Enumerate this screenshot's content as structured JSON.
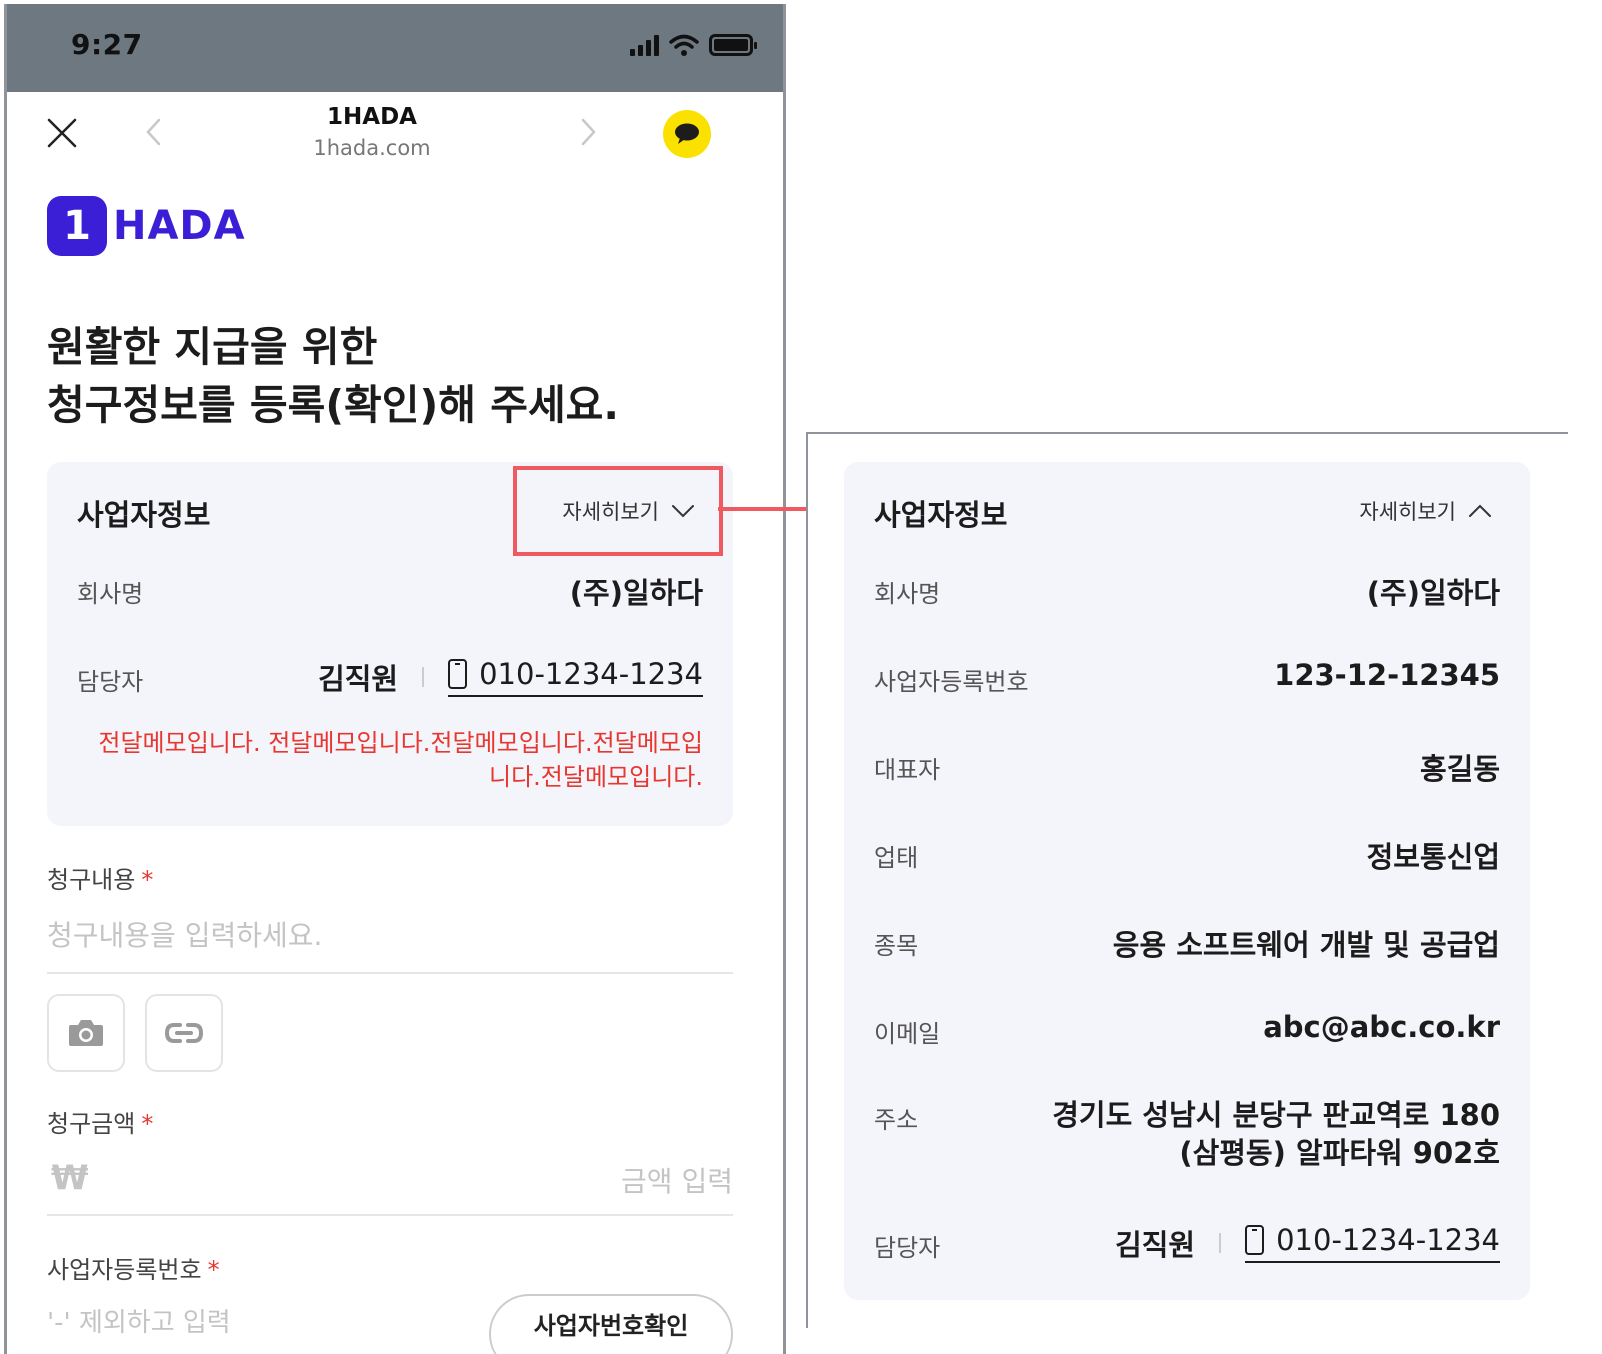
{
  "status_bar": {
    "time": "9:27"
  },
  "browser": {
    "title": "1HADA",
    "url": "1hada.com"
  },
  "logo": {
    "badge": "1",
    "text": "HADA"
  },
  "headline": {
    "line1": "원활한 지급을 위한",
    "line2": "청구정보를 등록(확인)해 주세요."
  },
  "business_card": {
    "title": "사업자정보",
    "toggle_label": "자세히보기",
    "company_label": "회사명",
    "company_value": "(주)일하다",
    "contact_label": "담당자",
    "contact_name": "김직원",
    "contact_phone": "010-1234-1234",
    "memo": "전달메모입니다. 전달메모입니다.전달메모입니다.전달메모입니다.전달메모입니다."
  },
  "form": {
    "content_label": "청구내용",
    "content_placeholder": "청구내용을 입력하세요.",
    "amount_label": "청구금액",
    "currency_symbol": "₩",
    "amount_placeholder": "금액 입력",
    "biz_no_label": "사업자등록번호",
    "biz_no_placeholder": "'-' 제외하고 입력",
    "biz_no_check_button": "사업자번호확인",
    "required_mark": "*"
  },
  "expanded_card": {
    "title": "사업자정보",
    "toggle_label": "자세히보기",
    "rows": [
      {
        "label": "회사명",
        "value": "(주)일하다"
      },
      {
        "label": "사업자등록번호",
        "value": "123-12-12345"
      },
      {
        "label": "대표자",
        "value": "홍길동"
      },
      {
        "label": "업태",
        "value": "정보통신업"
      },
      {
        "label": "종목",
        "value": "응용 소프트웨어 개발 및 공급업"
      },
      {
        "label": "이메일",
        "value": "abc@abc.co.kr"
      },
      {
        "label": "주소",
        "value_line1": "경기도 성남시 분당구 판교역로 180",
        "value_line2": "(삼평동) 알파타워 902호"
      }
    ],
    "contact_label": "담당자",
    "contact_name": "김직원",
    "contact_phone": "010-1234-1234"
  },
  "colors": {
    "brand": "#3b1fd6",
    "card_bg": "#f4f4fb",
    "memo_red": "#e8372f",
    "highlight": "#ef5a60",
    "kakao_yellow": "#fae100",
    "status_bar": "#6d7880"
  },
  "icons": {
    "close": "close-icon",
    "back": "chevron-left-icon",
    "forward": "chevron-right-icon",
    "kakao": "kakao-chat-icon",
    "toggle_collapsed": "chevron-down-icon",
    "toggle_expanded": "chevron-up-icon",
    "phone": "mobile-phone-icon",
    "camera": "camera-icon",
    "link": "link-icon"
  }
}
